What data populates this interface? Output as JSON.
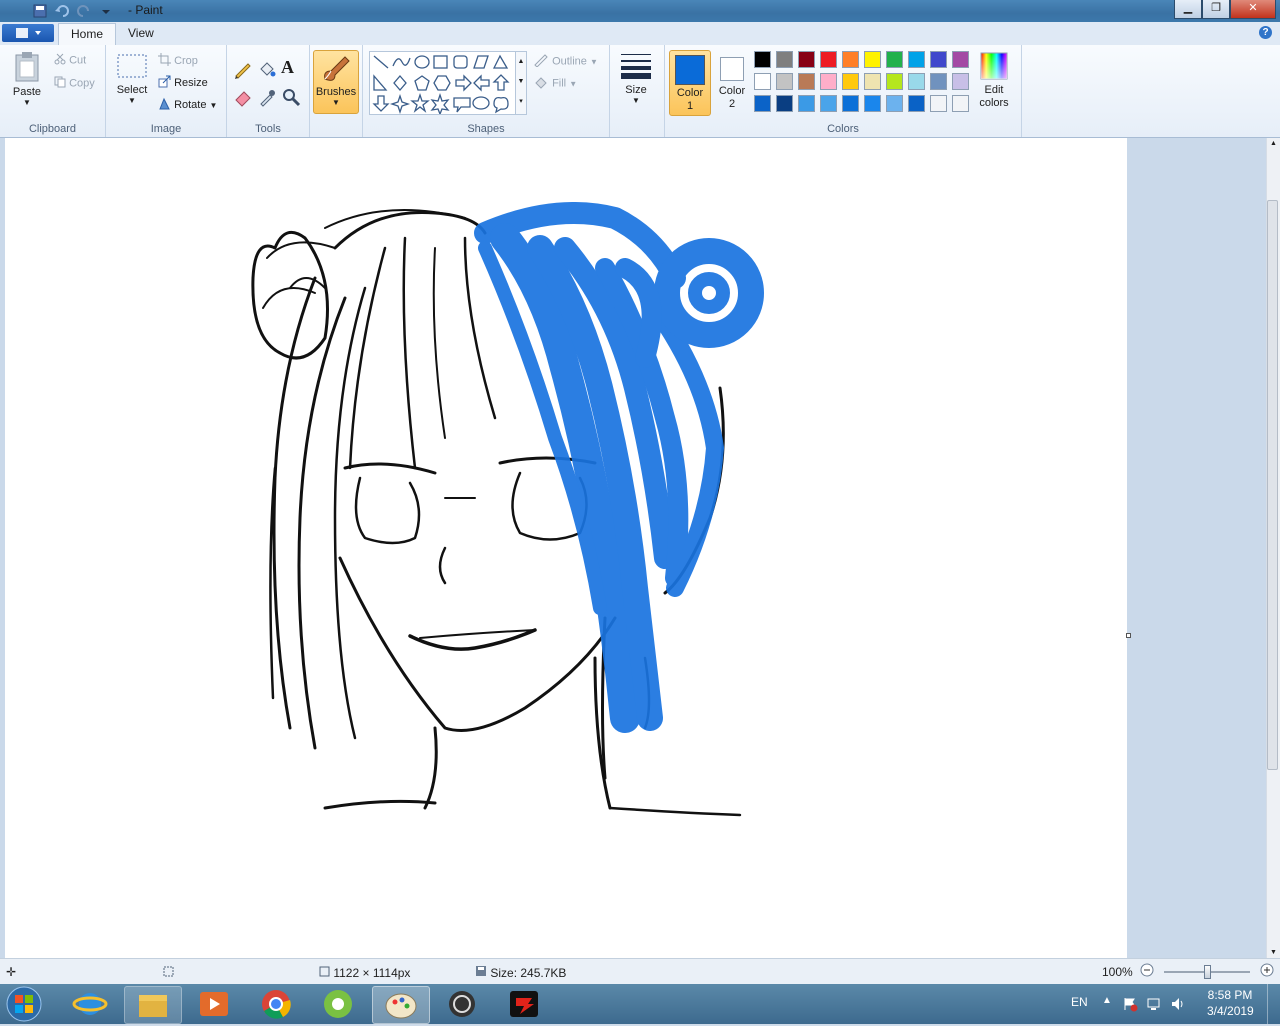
{
  "window": {
    "title": "- Paint"
  },
  "tabs": [
    {
      "label": "Home"
    },
    {
      "label": "View"
    }
  ],
  "clipboard": {
    "paste": "Paste",
    "cut": "Cut",
    "copy": "Copy",
    "group": "Clipboard"
  },
  "image": {
    "select": "Select",
    "crop": "Crop",
    "resize": "Resize",
    "rotate": "Rotate",
    "group": "Image"
  },
  "tools": {
    "group": "Tools",
    "text_glyph": "A"
  },
  "brushes": {
    "label": "Brushes"
  },
  "shapes": {
    "outline": "Outline",
    "fill": "Fill",
    "group": "Shapes"
  },
  "size": {
    "label": "Size"
  },
  "colors": {
    "color1_label": "Color 1",
    "color2_label": "Color 2",
    "edit_label": "Edit colors",
    "group": "Colors",
    "color1": "#0a6bd8",
    "color2": "#ffffff",
    "palette": [
      "#000000",
      "#7f7f7f",
      "#880015",
      "#ed1c24",
      "#ff7f27",
      "#fff200",
      "#22b14c",
      "#00a2e8",
      "#3f48cc",
      "#a349a4",
      "#ffffff",
      "#c3c3c3",
      "#b97a57",
      "#ffaec9",
      "#ffc90e",
      "#efe4b0",
      "#b5e61d",
      "#99d9ea",
      "#7092be",
      "#c8bfe7",
      "#0b63c8",
      "#0a3e82",
      "#3b9ae6",
      "#4aa4ea",
      "#0b70d8",
      "#1a86ec",
      "#6cb2ee",
      "#0a62c6",
      "#f2f4f7",
      "#f2f4f7"
    ]
  },
  "status": {
    "dimensions": "1122 × 1114px",
    "size": "Size: 245.7KB",
    "zoom": "100%",
    "zoom_percent": 100
  },
  "tray": {
    "lang": "EN",
    "time": "8:58 PM",
    "date": "3/4/2019"
  },
  "drawing": {
    "hair_color": "#1a74e0",
    "line_color": "#111111"
  }
}
